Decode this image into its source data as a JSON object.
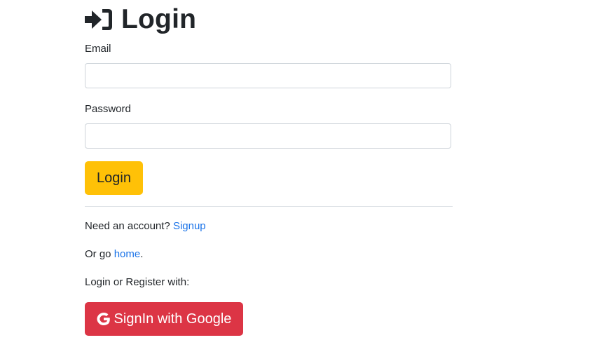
{
  "header": {
    "title": "Login",
    "icon": "sign-in-icon"
  },
  "form": {
    "email_label": "Email",
    "email_value": "",
    "password_label": "Password",
    "password_value": "",
    "submit_label": "Login"
  },
  "links": {
    "signup_prefix": "Need an account?",
    "signup_link": "Signup",
    "home_prefix": "Or go",
    "home_link": "home",
    "home_suffix": ".",
    "social_prompt": "Login or Register with:"
  },
  "social": {
    "google_label": "SignIn with Google",
    "google_icon": "google-icon"
  },
  "colors": {
    "login_button": "#ffc107",
    "google_button": "#dc3545",
    "link": "#1a73e8"
  }
}
